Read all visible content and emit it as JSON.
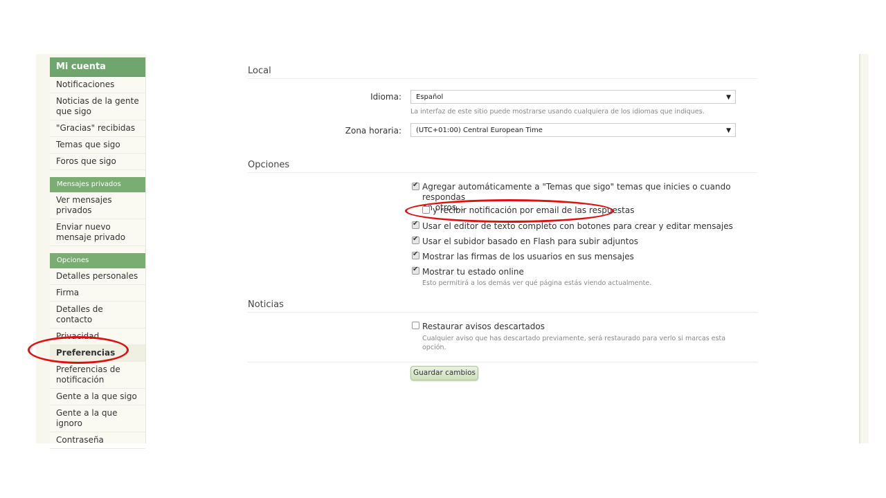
{
  "sidebar": {
    "header": "Mi cuenta",
    "account_items": [
      "Notificaciones",
      "Noticias de la gente que sigo",
      "\"Gracias\" recibidas",
      "Temas que sigo",
      "Foros que sigo"
    ],
    "pm_section": "Mensajes privados",
    "pm_items": [
      "Ver mensajes privados",
      "Enviar nuevo mensaje privado"
    ],
    "options_section": "Opciones",
    "options_items": [
      "Detalles personales",
      "Firma",
      "Detalles de contacto",
      "Privacidad",
      "Preferencias",
      "Preferencias de notificación",
      "Gente a la que sigo",
      "Gente a la que ignoro",
      "Contraseña"
    ],
    "active_item": "Preferencias"
  },
  "local": {
    "title": "Local",
    "language_label": "Idioma:",
    "language_value": "Español",
    "language_hint": "La interfaz de este sitio puede mostrarse usando cualquiera de los idiomas que indiques.",
    "timezone_label": "Zona horaria:",
    "timezone_value": "(UTC+01:00) Central European Time"
  },
  "options": {
    "title": "Opciones",
    "auto_follow_line1": "Agregar automáticamente a \"Temas que sigo\" temas que inicies o cuando respondas",
    "auto_follow_line2": "en otros...",
    "email_notify": "y recibir notificación por email de las respuestas",
    "full_editor": "Usar el editor de texto completo con botones para crear y editar mensajes",
    "flash_uploader": "Usar el subidor basado en Flash para subir adjuntos",
    "show_signatures": "Mostrar las firmas de los usuarios en sus mensajes",
    "show_online": "Mostrar tu estado online",
    "show_online_hint": "Esto permitirá a los demás ver qué página estás viendo actualmente."
  },
  "news": {
    "title": "Noticias",
    "restore_notices": "Restaurar avisos descartados",
    "restore_hint_line1": "Cualquier aviso que has descartado previamente, será restaurado para verlo si marcas esta",
    "restore_hint_line2": "opción."
  },
  "save_label": "Guardar cambios",
  "colors": {
    "accent": "#6ea66e",
    "annotation": "#e01010"
  }
}
